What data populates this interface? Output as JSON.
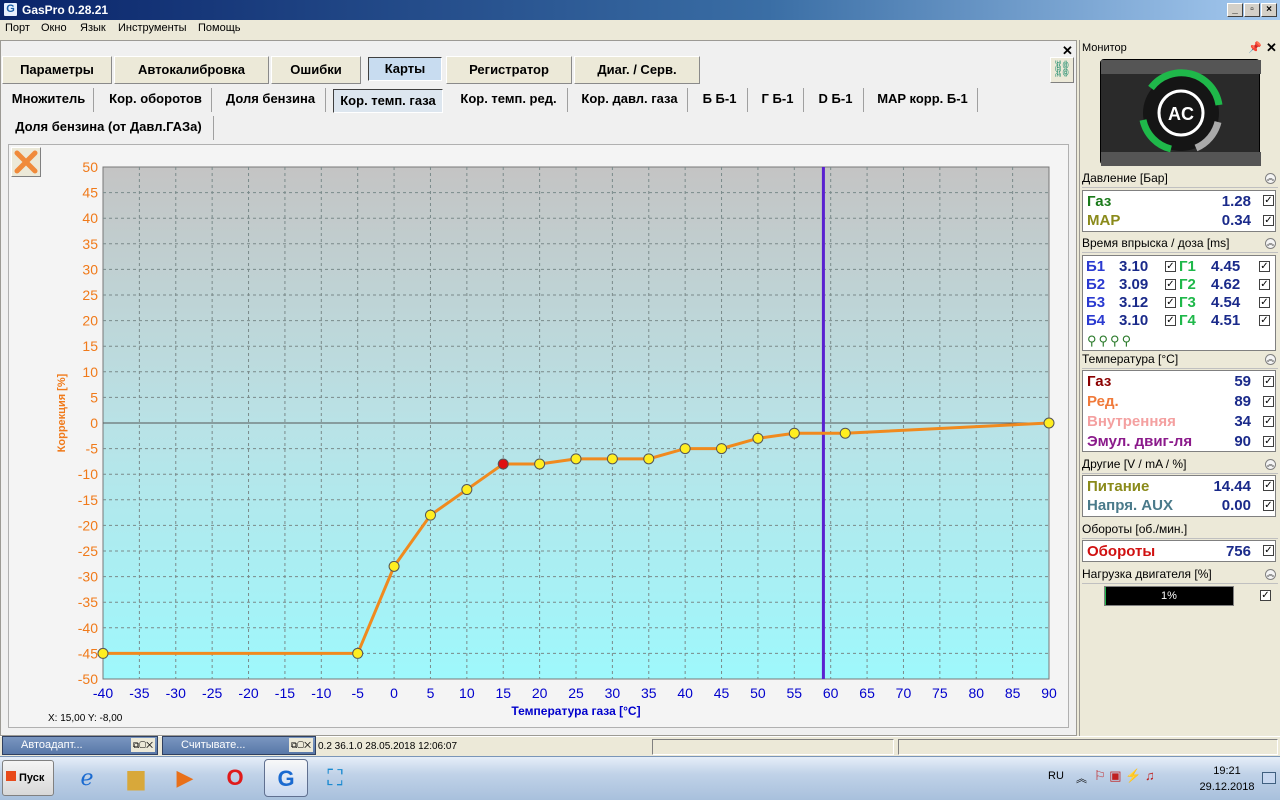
{
  "window": {
    "title": "GasPro 0.28.21",
    "min": "_",
    "max": "▫",
    "close": "×"
  },
  "menu": [
    "Порт",
    "Окно",
    "Язык",
    "Инструменты",
    "Помощь"
  ],
  "tabs": [
    "Параметры",
    "Автокалибровка",
    "Ошибки",
    "Карты",
    "Регистратор",
    "Диаг. / Серв."
  ],
  "subtabs": [
    "Множитель",
    "Кор. оборотов",
    "Доля бензина",
    "Кор. темп. газа",
    "Кор. темп. ред.",
    "Кор. давл. газа",
    "Б Б-1",
    "Г Б-1",
    "D Б-1",
    "MAP корр. Б-1"
  ],
  "subtabs2": [
    "Доля бензина (от Давл.ГАЗа)"
  ],
  "chart_data": {
    "type": "line",
    "xlabel": "Температура газа [°C]",
    "ylabel": "Коррекция [%]",
    "xlim": [
      -40,
      90
    ],
    "ylim": [
      -50,
      50
    ],
    "xticks": [
      -40,
      -35,
      -30,
      -25,
      -20,
      -15,
      -10,
      -5,
      0,
      5,
      10,
      15,
      20,
      25,
      30,
      35,
      40,
      45,
      50,
      55,
      60,
      65,
      70,
      75,
      80,
      85,
      90
    ],
    "yticks": [
      50,
      45,
      40,
      35,
      30,
      25,
      20,
      15,
      10,
      5,
      0,
      -5,
      -10,
      -15,
      -20,
      -25,
      -30,
      -35,
      -40,
      -45,
      -50
    ],
    "x": [
      -40,
      -5,
      0,
      5,
      10,
      15,
      20,
      25,
      30,
      35,
      40,
      45,
      50,
      55,
      62,
      90
    ],
    "y": [
      -45,
      -45,
      -28,
      -18,
      -13,
      -8,
      -8,
      -7,
      -7,
      -7,
      -5,
      -5,
      -3,
      -2,
      -2,
      0
    ],
    "selected_index": 5,
    "cursor_x": 59,
    "line_color": "#f08a1e",
    "cursor_color": "#5a20d0"
  },
  "coord_readout": "X: 15,00  Y: -8,00",
  "monitor": {
    "title": "Монитор",
    "pressure_head": "Давление [Бар]",
    "gas_label": "Газ",
    "gas_val": "1.28",
    "map_label": "MAP",
    "map_val": "0.34",
    "inj_head": "Время впрыска / доза [ms]",
    "inj": [
      {
        "b": "Б1",
        "bv": "3.10",
        "g": "Г1",
        "gv": "4.45"
      },
      {
        "b": "Б2",
        "bv": "3.09",
        "g": "Г2",
        "gv": "4.62"
      },
      {
        "b": "Б3",
        "bv": "3.12",
        "g": "Г3",
        "gv": "4.54"
      },
      {
        "b": "Б4",
        "bv": "3.10",
        "g": "Г4",
        "gv": "4.51"
      }
    ],
    "temp_head": "Температура [°C]",
    "temps": [
      {
        "label": "Газ",
        "val": "59",
        "color": "#8b0000"
      },
      {
        "label": "Ред.",
        "val": "89",
        "color": "#f07a3a"
      },
      {
        "label": "Внутренняя",
        "val": "34",
        "color": "#f4a0a0"
      },
      {
        "label": "Эмул. двиг-ля",
        "val": "90",
        "color": "#8b1a8b"
      }
    ],
    "other_head": "Другие [V / mA / %]",
    "power_label": "Питание",
    "power_val": "14.44",
    "aux_label": "Напря. AUX",
    "aux_val": "0.00",
    "rpm_head": "Обороты [об./мин.]",
    "rpm_label": "Обороты",
    "rpm_val": "756",
    "load_head": "Нагрузка двигателя [%]",
    "load_val": "1%",
    "load_fraction": 0.01
  },
  "statusbar": {
    "text1": "0.2  36.1.0   28.05.2018 12:06:07"
  },
  "mini_windows": [
    "Автоадапт...",
    "Считывате..."
  ],
  "taskbar": {
    "start": "Пуск",
    "lang": "RU",
    "time": "19:21",
    "date": "29.12.2018"
  }
}
